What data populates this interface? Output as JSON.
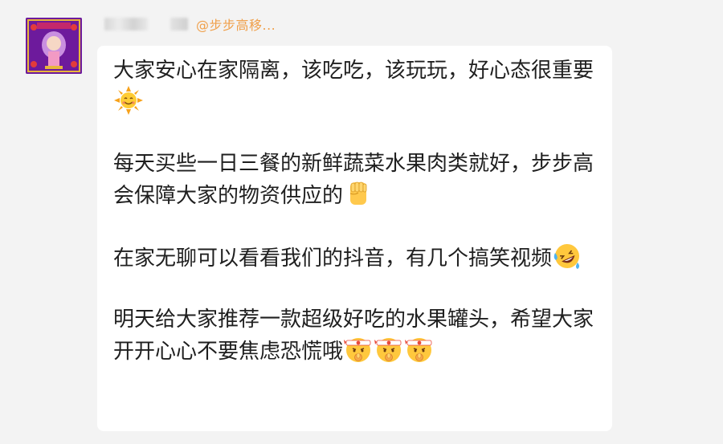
{
  "sender": {
    "group_nickname": "@步步高移..."
  },
  "message": {
    "paragraphs": [
      {
        "text": "大家安心在家隔离，该吃吃，该玩玩，好心态很重要",
        "emojis": [
          "sun-smile"
        ]
      },
      {
        "text": "每天买些一日三餐的新鲜蔬菜水果肉类就好，步步高会保障大家的物资供应的",
        "emojis": [
          "raised-fist"
        ]
      },
      {
        "text": "在家无聊可以看看我们的抖音，有几个搞笑视频",
        "emojis": [
          "rolling-laugh"
        ]
      },
      {
        "text": "明天给大家推荐一款超级好吃的水果罐头，希望大家开开心心不要焦虑恐慌哦",
        "emojis": [
          "headband-face",
          "headband-face",
          "headband-face"
        ]
      }
    ]
  },
  "colors": {
    "background": "#f3f3f3",
    "bubble": "#ffffff",
    "nickname": "#f0a04b",
    "text": "#1f1f1f"
  }
}
